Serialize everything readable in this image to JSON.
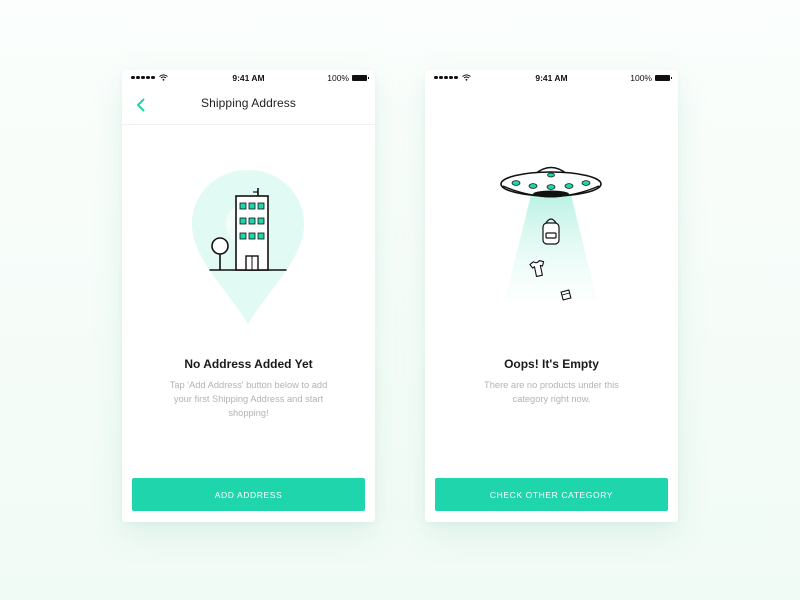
{
  "status_bar": {
    "time": "9:41 AM",
    "battery": "100%"
  },
  "screens": [
    {
      "nav": {
        "title": "Shipping Address"
      },
      "heading": "No Address Added Yet",
      "description": "Tap 'Add Address' button below to add your first Shipping Address and start shopping!",
      "button_label": "ADD ADDRESS"
    },
    {
      "heading": "Oops! It's Empty",
      "description": "There are no products under this category right now.",
      "button_label": "CHECK OTHER CATEGORY"
    }
  ],
  "colors": {
    "accent": "#1fd5ac",
    "accent_light": "#e2faf4",
    "text": "#1a1a1a",
    "muted": "#b3b3b3"
  },
  "icons": [
    "signal-dots-icon",
    "wifi-icon",
    "battery-icon",
    "back-chevron-icon",
    "building-pin-illustration",
    "ufo-illustration",
    "backpack-icon",
    "tshirt-icon",
    "box-icon"
  ]
}
